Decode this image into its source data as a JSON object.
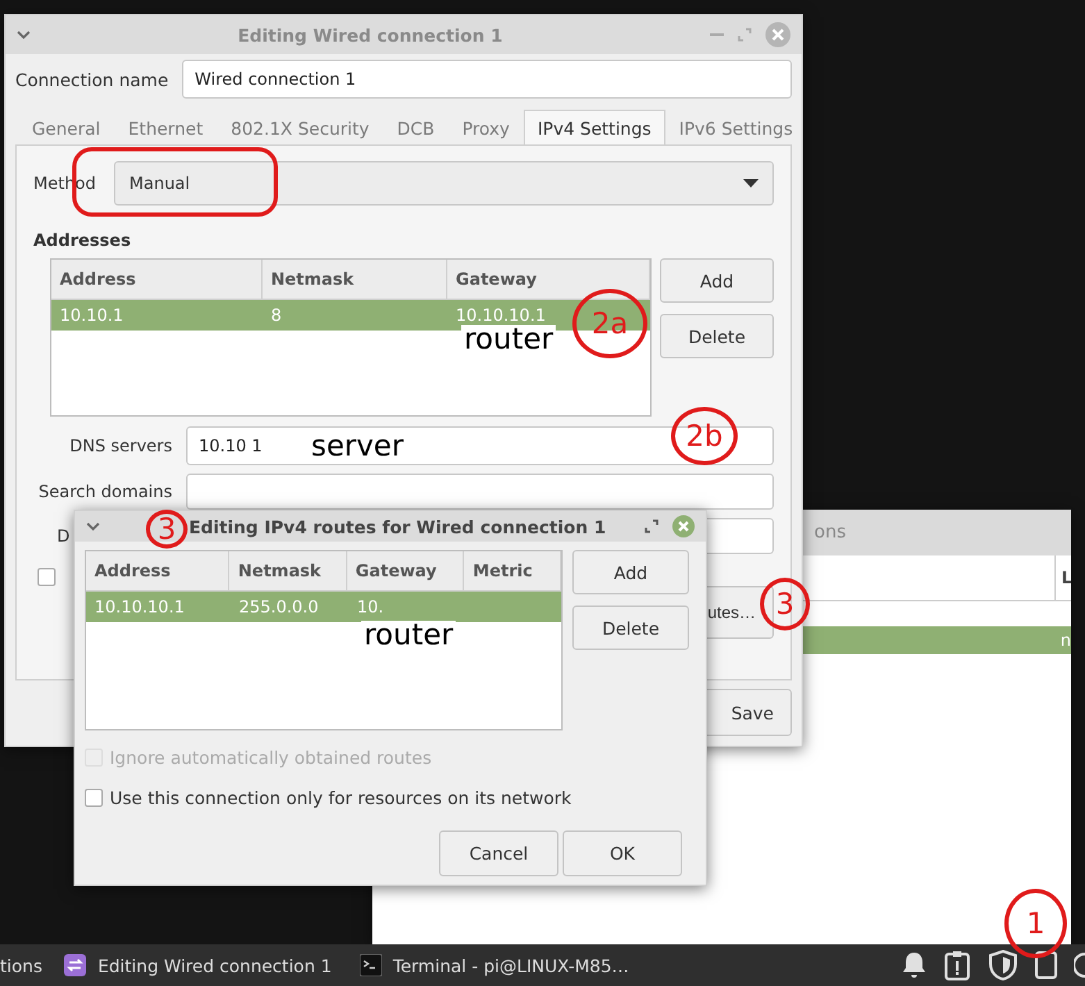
{
  "back_window": {
    "title": "ons",
    "column_header": "L",
    "row_text": "n"
  },
  "main_dialog": {
    "title": "Editing Wired connection 1",
    "connection_name_label": "Connection name",
    "connection_name": "Wired connection 1",
    "tabs": [
      {
        "label": "General",
        "selected": false
      },
      {
        "label": "Ethernet",
        "selected": false
      },
      {
        "label": "802.1X Security",
        "selected": false
      },
      {
        "label": "DCB",
        "selected": false
      },
      {
        "label": "Proxy",
        "selected": false
      },
      {
        "label": "IPv4 Settings",
        "selected": true
      },
      {
        "label": "IPv6 Settings",
        "selected": false
      }
    ],
    "method_label": "Method",
    "method": "Manual",
    "addresses_label": "Addresses",
    "addresses_table": {
      "columns": [
        "Address",
        "Netmask",
        "Gateway"
      ],
      "rows": [
        {
          "cells": [
            "10.10.1",
            "8",
            "10.10.10.1"
          ],
          "selected": true
        }
      ]
    },
    "address_buttons": [
      "Add",
      "Delete"
    ],
    "dns_label": "DNS servers",
    "dns_value": "10.10 1",
    "search_domains_label": "Search domains",
    "covered_label": "D",
    "covered_checkbox": {
      "checked": false
    },
    "routes_button": "utes…",
    "save_button": "Save"
  },
  "routes_dialog": {
    "title": "Editing IPv4 routes for Wired connection 1",
    "table": {
      "columns": [
        "Address",
        "Netmask",
        "Gateway",
        "Metric"
      ],
      "rows": [
        {
          "cells": [
            "10.10.10.1",
            "255.0.0.0",
            "10."
          ],
          "selected": true
        }
      ]
    },
    "buttons": [
      "Add",
      "Delete"
    ],
    "options": [
      {
        "label": "Ignore automatically obtained routes",
        "checked": false,
        "disabled": true
      },
      {
        "label": "Use this connection only for resources on its network",
        "checked": false,
        "disabled": false
      }
    ],
    "actions": [
      "Cancel",
      "OK"
    ]
  },
  "taskbar": {
    "items": [
      {
        "label": "tions",
        "kind": "plain"
      },
      {
        "label": "Editing Wired connection 1",
        "kind": "settings"
      },
      {
        "label": "Terminal - pi@LINUX-M85…",
        "kind": "terminal"
      }
    ]
  },
  "annotations": [
    {
      "kind": "outline"
    },
    {
      "kind": "circle",
      "label": "2a"
    },
    {
      "kind": "note",
      "label": "router"
    },
    {
      "kind": "circle",
      "label": "2b"
    },
    {
      "kind": "note",
      "label": "server"
    },
    {
      "kind": "circle",
      "label": "3"
    },
    {
      "kind": "circle",
      "label": "3"
    },
    {
      "kind": "note",
      "label": "router"
    },
    {
      "kind": "circle",
      "label": "1"
    }
  ]
}
